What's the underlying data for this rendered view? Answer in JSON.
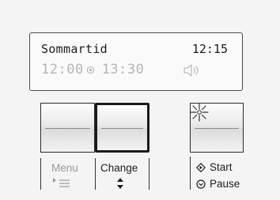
{
  "display": {
    "mode_text": "Sommartid",
    "clock": "12:15",
    "start_time": "12:00",
    "end_time": "13:30",
    "row2_start_icon": "temperature-dot-icon",
    "row2_right_icon": "speaker-icon"
  },
  "buttons": {
    "menu": {
      "label": "Menu",
      "icon": "menu-arrow-lines-icon",
      "dimmed": true
    },
    "change": {
      "label": "Change",
      "icon": "up-down-arrows-icon",
      "selected": true
    },
    "start_pause": {
      "start_label": "Start",
      "pause_label": "Pause",
      "indicator": "burst-indicator-icon"
    }
  },
  "colors": {
    "frame": "#2b2b2b",
    "dim_text": "#9a9a9a",
    "lcd_dim": "#b5b5b5"
  }
}
